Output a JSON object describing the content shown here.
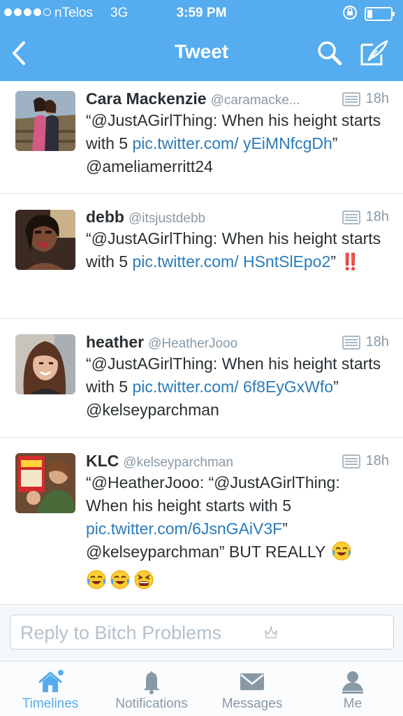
{
  "status_bar": {
    "carrier": "nTelos",
    "network": "3G",
    "time": "3:59 PM"
  },
  "nav": {
    "title": "Tweet",
    "back_icon": "chevron-left-icon",
    "search_icon": "search-icon",
    "compose_icon": "compose-icon"
  },
  "tweets": [
    {
      "name": "Cara Mackenzie",
      "handle": "@caramacke...",
      "time": "18h",
      "text_1": "“@JustAGirlThing: When his height starts with 5 ",
      "link": "pic.twitter.com/ yEiMNfcgDh",
      "text_2": "” @ameliamerritt24"
    },
    {
      "name": "debb",
      "handle": "@itsjustdebb",
      "time": "18h",
      "text_1": "“@JustAGirlThing: When his height starts with 5 ",
      "link": "pic.twitter.com/ HSntSlEpo2",
      "text_2": "” ",
      "emoji": "‼️"
    },
    {
      "name": "heather",
      "handle": "@HeatherJooo",
      "time": "18h",
      "text_1": "“@JustAGirlThing: When his height starts with 5 ",
      "link": "pic.twitter.com/ 6f8EyGxWfo",
      "text_2": "” @kelseyparchman"
    },
    {
      "name": "KLC",
      "handle": "@kelseyparchman",
      "time": "18h",
      "text_1": "“@HeatherJooo: “@JustAGirlThing: When his height starts with 5 ",
      "link": "pic.twitter.com/6JsnGAiV3F",
      "text_2": "” @kelseyparchman” BUT REALLY"
    }
  ],
  "reply": {
    "placeholder": "Reply to Bitch Problems"
  },
  "tabs": [
    {
      "label": "Timelines",
      "icon": "home-icon",
      "active": true
    },
    {
      "label": "Notifications",
      "icon": "bell-icon",
      "active": false
    },
    {
      "label": "Messages",
      "icon": "envelope-icon",
      "active": false
    },
    {
      "label": "Me",
      "icon": "person-icon",
      "active": false
    }
  ],
  "colors": {
    "brand": "#55acee",
    "link": "#2b7bb9",
    "text": "#292f33",
    "muted": "#8899a6"
  }
}
